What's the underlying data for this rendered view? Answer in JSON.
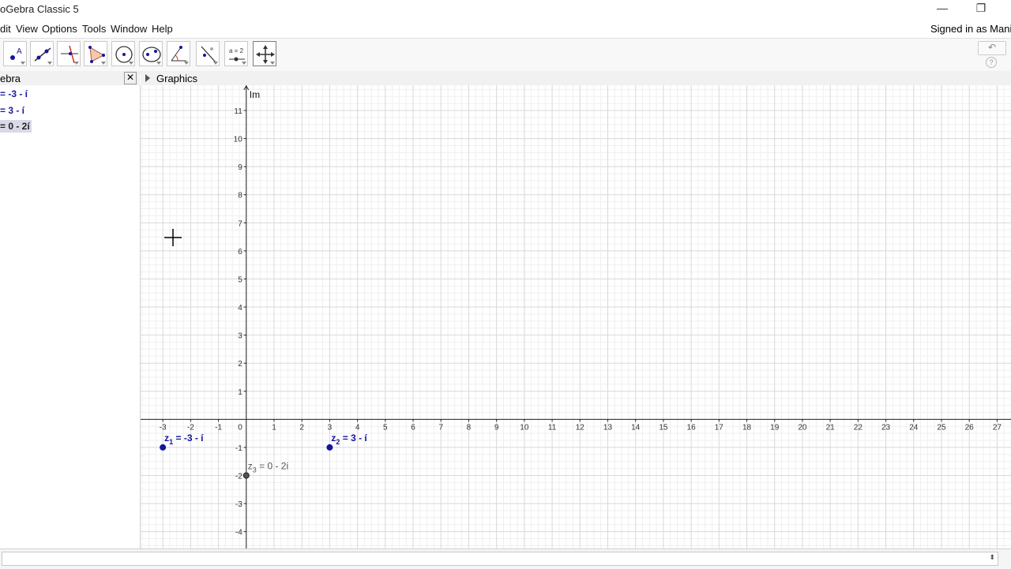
{
  "window": {
    "title": "oGebra Classic 5",
    "minimize_label": "—",
    "restore_label": "❐"
  },
  "menu": {
    "items": [
      "dit",
      "View",
      "Options",
      "Tools",
      "Window",
      "Help"
    ],
    "signed_in": "Signed in as Manis"
  },
  "toolbar": {
    "tools": [
      {
        "icon": "point-icon"
      },
      {
        "icon": "line-icon"
      },
      {
        "icon": "perpendicular-line-icon"
      },
      {
        "icon": "polygon-icon"
      },
      {
        "icon": "circle-center-point-icon"
      },
      {
        "icon": "ellipse-icon"
      },
      {
        "icon": "angle-icon"
      },
      {
        "icon": "reflect-icon"
      },
      {
        "icon": "slider-icon",
        "text": "a = 2"
      },
      {
        "icon": "move-graphics-icon"
      }
    ],
    "undo_label": "↶",
    "help_label": "?"
  },
  "algebra": {
    "header": "ebra",
    "close_label": "✕",
    "items": [
      "= -3 - í",
      "= 3 - í",
      "= 0 - 2í"
    ],
    "selected_index": 2
  },
  "graphics": {
    "header": "Graphics",
    "y_axis_label": "Im",
    "x_ticks": [
      -3,
      -2,
      -1,
      1,
      2,
      3,
      4,
      5,
      6,
      7,
      8,
      9,
      10,
      11,
      12,
      13,
      14,
      15,
      16,
      17,
      18,
      19,
      20,
      21,
      22,
      23,
      24,
      25,
      26,
      27
    ],
    "y_ticks": [
      -4,
      -3,
      -2,
      -1,
      1,
      2,
      3,
      4,
      5,
      6,
      7,
      8,
      9,
      10,
      11
    ],
    "origin_label": "0",
    "x_range": [
      -3.8,
      27.5
    ],
    "y_range": [
      -4.6,
      11.9
    ],
    "points": [
      {
        "name": "z",
        "sub": "1",
        "label": " = -3 - í",
        "x": -3,
        "y": -1,
        "color": "#1414a0",
        "bold": true
      },
      {
        "name": "z",
        "sub": "2",
        "label": " = 3 - í",
        "x": 3,
        "y": -1,
        "color": "#1414a0",
        "bold": true
      },
      {
        "name": "z",
        "sub": "3",
        "label": " = 0 - 2i",
        "x": 0,
        "y": -2,
        "color": "#555555",
        "bold": false
      }
    ]
  }
}
